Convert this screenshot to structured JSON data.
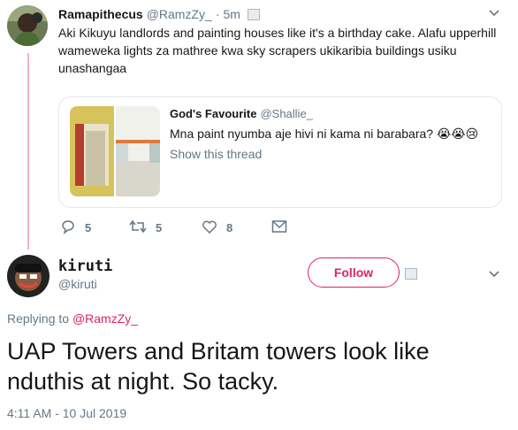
{
  "tweet1": {
    "author_name": "Ramapithecus",
    "handle": "@RamzZy_",
    "separator": "·",
    "time": "5m",
    "text": "Aki Kikuyu landlords and painting houses like it's a birthday cake. Alafu upperhill wameweka lights za mathree kwa sky scrapers ukikaribia buildings usiku unashangaa",
    "quote": {
      "author_name": "God's Favourite",
      "handle": "@Shallie_",
      "text": "Mna paint nyumba aje hivi ni kama ni barabara? 😭😭😢",
      "show_thread": "Show this thread"
    },
    "actions": {
      "reply_count": "5",
      "retweet_count": "5",
      "like_count": "8"
    }
  },
  "tweet2": {
    "author_name": "kiruti",
    "handle": "@kiruti",
    "follow_label": "Follow",
    "replying_prefix": "Replying to",
    "replying_to": "@RamzZy_",
    "text": "UAP Towers and Britam towers look like nduthis at night. So tacky.",
    "timestamp": "4:11 AM - 10 Jul 2019"
  },
  "colors": {
    "accent": "#e0245e",
    "link": "#e0245e",
    "thread_line": "#f4b3c2",
    "muted": "#657786"
  },
  "icons": [
    "reply-icon",
    "retweet-icon",
    "like-icon",
    "dm-icon",
    "chevron-down-icon",
    "badge-icon"
  ]
}
